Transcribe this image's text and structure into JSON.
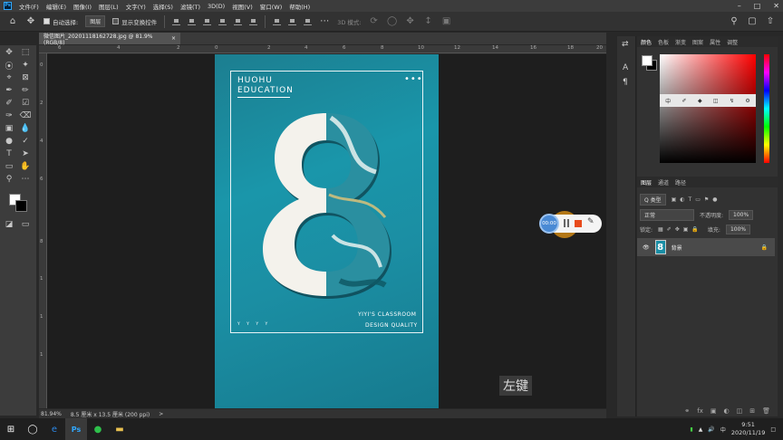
{
  "app": {
    "logo": "Ps"
  },
  "menu": [
    "文件(F)",
    "编辑(E)",
    "图像(I)",
    "图层(L)",
    "文字(Y)",
    "选择(S)",
    "滤镜(T)",
    "3D(D)",
    "视图(V)",
    "窗口(W)",
    "帮助(H)"
  ],
  "options": {
    "auto_select": "自动选择:",
    "layer_dd": "图层",
    "show_transform": "显示变换控件",
    "mode3d": "3D 模式:"
  },
  "document": {
    "tab_title": "微信图片_20201118162728.jpg @ 81.9%(RGB/8)",
    "close": "×"
  },
  "ruler_top": [
    "6",
    "4",
    "2",
    "0",
    "2",
    "4",
    "6",
    "8",
    "10",
    "12",
    "14",
    "16",
    "18",
    "20"
  ],
  "ruler_left": [
    "0",
    "2",
    "4",
    "6",
    "8",
    "1",
    "1",
    "1"
  ],
  "poster": {
    "title1": "HUOHU",
    "title2": "EDUCATION",
    "dots": "•••",
    "classroom": "YIYI'S CLASSROOM",
    "quality": "DESIGN QUALITY",
    "yiyi": "Y Y Y Y"
  },
  "key_hint": "左键",
  "recorder": {
    "time": "00:00"
  },
  "status": {
    "zoom": "81.94%",
    "size": "8.5 厘米 x 13.5 厘米 (200 ppi)",
    "arrow": ">"
  },
  "color_panel": {
    "tabs": [
      "颜色",
      "色板",
      "渐变",
      "图案",
      "属性",
      "调整"
    ],
    "btn": "中"
  },
  "layers_panel": {
    "tabs": [
      "图层",
      "通道",
      "路径"
    ],
    "filter": "Q 类型",
    "blend": "正常",
    "opacity_label": "不透明度:",
    "opacity": "100%",
    "lock_label": "锁定:",
    "fill_label": "填充:",
    "fill": "100%",
    "layer_name": "背景",
    "thumb": "8"
  },
  "taskbar": {
    "time": "9:51",
    "date": "2020/11/19"
  },
  "colors": {
    "accent": "#31a8ff",
    "poster": "#1a8ea5"
  }
}
